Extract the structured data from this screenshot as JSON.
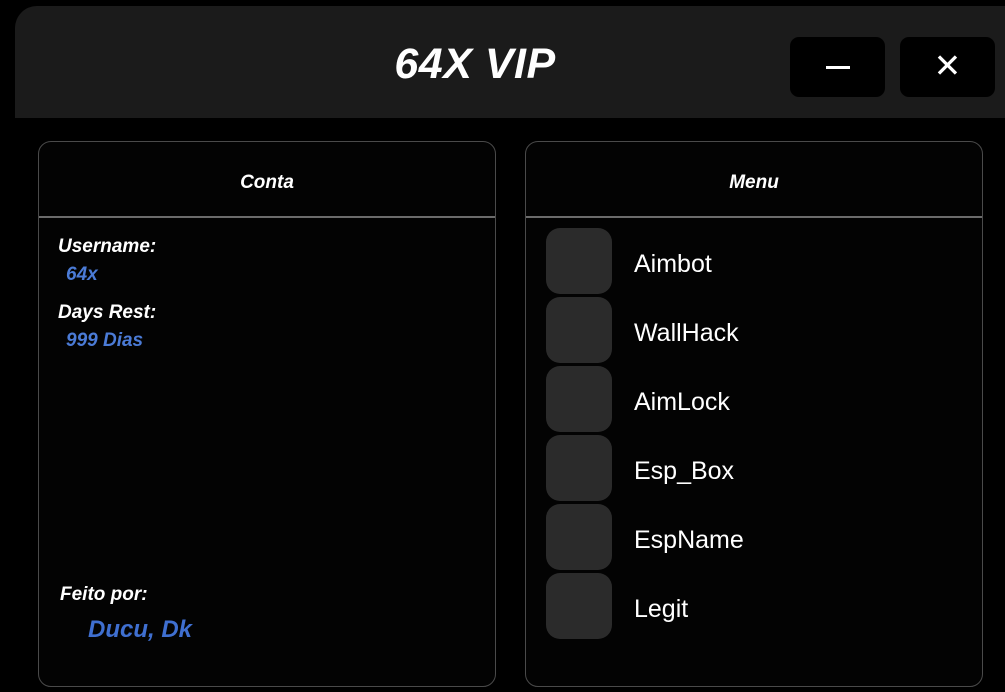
{
  "window": {
    "title": "64X VIP",
    "minimize_icon": "minimize-icon",
    "close_icon": "close-icon",
    "close_glyph": "✕"
  },
  "account_panel": {
    "header": "Conta",
    "username_label": "Username:",
    "username_value": "64x",
    "days_label": "Days Rest:",
    "days_value": "999 Dias",
    "credits_label": "Feito por:",
    "credits_value": "Ducu, Dk"
  },
  "menu_panel": {
    "header": "Menu",
    "items": [
      {
        "label": "Aimbot",
        "enabled": false
      },
      {
        "label": "WallHack",
        "enabled": false
      },
      {
        "label": "AimLock",
        "enabled": false
      },
      {
        "label": "Esp_Box",
        "enabled": false
      },
      {
        "label": "EspName",
        "enabled": false
      },
      {
        "label": "Legit",
        "enabled": false
      }
    ]
  },
  "colors": {
    "background": "#000000",
    "titlebar": "#1b1b1b",
    "accent_blue": "#4b7bd6",
    "toggle_off": "#2b2b2b",
    "divider": "#6b6b6b"
  }
}
